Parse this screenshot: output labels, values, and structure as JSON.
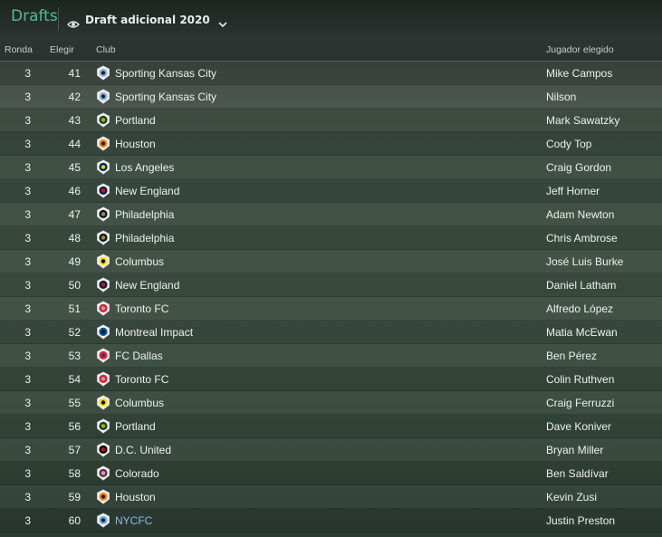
{
  "app": {
    "title": "Drafts",
    "selector_label": "Draft adicional 2020"
  },
  "columns": {
    "ronda": "Ronda",
    "elegir": "Elegir",
    "club": "Club",
    "player": "Jugador elegido"
  },
  "picks": [
    {
      "ronda": "3",
      "elegir": "41",
      "club": "Sporting Kansas City",
      "player": "Mike Campos",
      "crest": "crest-skc"
    },
    {
      "ronda": "3",
      "elegir": "42",
      "club": "Sporting Kansas City",
      "player": "Nilson",
      "crest": "crest-skc"
    },
    {
      "ronda": "3",
      "elegir": "43",
      "club": "Portland",
      "player": "Mark Sawatzky",
      "crest": "crest-portland"
    },
    {
      "ronda": "3",
      "elegir": "44",
      "club": "Houston",
      "player": "Cody Top",
      "crest": "crest-houston"
    },
    {
      "ronda": "3",
      "elegir": "45",
      "club": "Los Angeles",
      "player": "Craig Gordon",
      "crest": "crest-la"
    },
    {
      "ronda": "3",
      "elegir": "46",
      "club": "New England",
      "player": "Jeff Horner",
      "crest": "crest-newengland"
    },
    {
      "ronda": "3",
      "elegir": "47",
      "club": "Philadelphia",
      "player": "Adam Newton",
      "crest": "crest-philadelphia"
    },
    {
      "ronda": "3",
      "elegir": "48",
      "club": "Philadelphia",
      "player": "Chris Ambrose",
      "crest": "crest-philadelphia"
    },
    {
      "ronda": "3",
      "elegir": "49",
      "club": "Columbus",
      "player": "José Luis Burke",
      "crest": "crest-columbus"
    },
    {
      "ronda": "3",
      "elegir": "50",
      "club": "New England",
      "player": "Daniel Latham",
      "crest": "crest-newengland"
    },
    {
      "ronda": "3",
      "elegir": "51",
      "club": "Toronto FC",
      "player": "Alfredo López",
      "crest": "crest-toronto"
    },
    {
      "ronda": "3",
      "elegir": "52",
      "club": "Montreal Impact",
      "player": "Matia McEwan",
      "crest": "crest-montreal"
    },
    {
      "ronda": "3",
      "elegir": "53",
      "club": "FC Dallas",
      "player": "Ben Pérez",
      "crest": "crest-dallas"
    },
    {
      "ronda": "3",
      "elegir": "54",
      "club": "Toronto FC",
      "player": "Colin Ruthven",
      "crest": "crest-toronto"
    },
    {
      "ronda": "3",
      "elegir": "55",
      "club": "Columbus",
      "player": "Craig Ferruzzi",
      "crest": "crest-columbus"
    },
    {
      "ronda": "3",
      "elegir": "56",
      "club": "Portland",
      "player": "Dave Koniver",
      "crest": "crest-portland"
    },
    {
      "ronda": "3",
      "elegir": "57",
      "club": "D.C. United",
      "player": "Bryan Miller",
      "crest": "crest-dcunited"
    },
    {
      "ronda": "3",
      "elegir": "58",
      "club": "Colorado",
      "player": "Ben Saldívar",
      "crest": "crest-colorado"
    },
    {
      "ronda": "3",
      "elegir": "59",
      "club": "Houston",
      "player": "Kevin Zusi",
      "crest": "crest-houston"
    },
    {
      "ronda": "3",
      "elegir": "60",
      "club": "NYCFC",
      "player": "Justin Preston",
      "crest": "crest-nycfc",
      "link": true
    }
  ],
  "crest_colors": {
    "crest-skc": [
      "#93b1d7",
      "#0c2340"
    ],
    "crest-portland": [
      "#00482b",
      "#d69a00"
    ],
    "crest-houston": [
      "#f68712",
      "#231f20"
    ],
    "crest-la": [
      "#00245d",
      "#ffd200"
    ],
    "crest-newengland": [
      "#0a2240",
      "#ce0e2d"
    ],
    "crest-philadelphia": [
      "#071b2c",
      "#b1872d"
    ],
    "crest-columbus": [
      "#fedd00",
      "#000000"
    ],
    "crest-toronto": [
      "#e31937",
      "#a4a9ad"
    ],
    "crest-montreal": [
      "#00529b",
      "#1a1a1a"
    ],
    "crest-dallas": [
      "#e81f3e",
      "#2a4076"
    ],
    "crest-dcunited": [
      "#000000",
      "#d61018"
    ],
    "crest-colorado": [
      "#862633",
      "#8bb8e8"
    ],
    "crest-nycfc": [
      "#6cace4",
      "#041e42"
    ]
  },
  "accent": "#4fbf8c",
  "link_color": "#8fb8e8"
}
